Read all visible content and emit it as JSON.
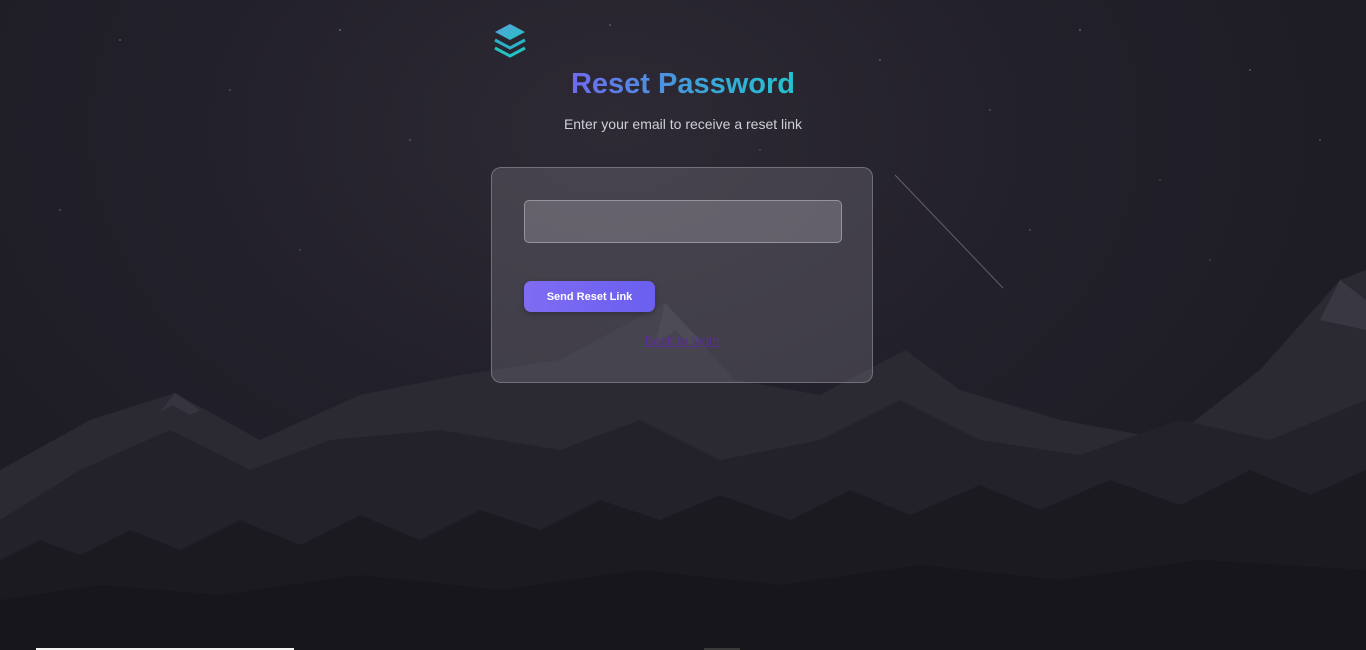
{
  "app": {
    "logo_icon": "layers-icon",
    "title": "Reset Password",
    "subtitle": "Enter your email to receive a reset link"
  },
  "form": {
    "email_value": "",
    "email_placeholder": "",
    "submit_label": "Send Reset Link",
    "back_link_label": "Back to login"
  },
  "colors": {
    "accent_start": "#6f6af0",
    "accent_end": "#22c3d0",
    "button": "#7266f1",
    "link": "#5a2f94"
  }
}
